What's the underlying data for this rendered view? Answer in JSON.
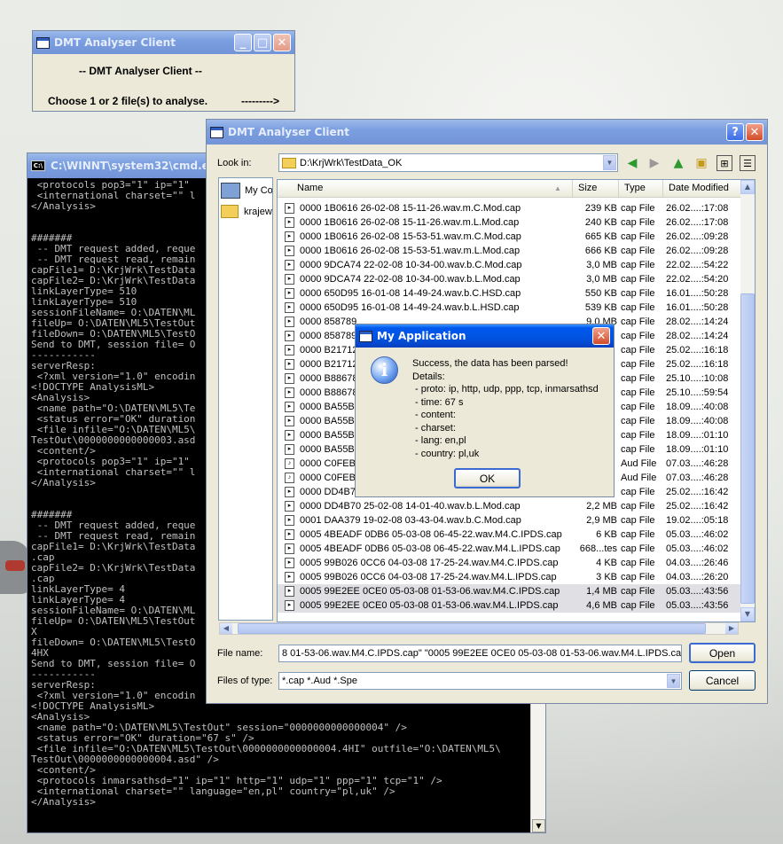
{
  "small_window": {
    "title": "DMT Analyser Client",
    "heading": "-- DMT Analyser Client --",
    "prompt": "Choose 1 or 2 file(s) to analyse.",
    "arrow": "--------->"
  },
  "cmd": {
    "title": "C:\\WINNT\\system32\\cmd.ex",
    "lines": [
      " <protocols pop3=\"1\" ip=\"1\"",
      " <international charset=\"\" l",
      "</Analysis>",
      "",
      "",
      "#######",
      " -- DMT request added, reque",
      " -- DMT request read, remain",
      "capFile1= D:\\KrjWrk\\TestData",
      "capFile2= D:\\KrjWrk\\TestData",
      "linkLayerType= 510",
      "linkLayerType= 510",
      "sessionFileName= O:\\DATEN\\ML",
      "fileUp= O:\\DATEN\\ML5\\TestOut",
      "fileDown= O:\\DATEN\\ML5\\TestO",
      "Send to DMT, session file= O",
      "-----------",
      "serverResp:",
      " <?xml version=\"1.0\" encodin",
      "<!DOCTYPE AnalysisML>",
      "<Analysis>",
      " <name path=\"O:\\DATEN\\ML5\\Te",
      " <status error=\"OK\" duration",
      " <file infile=\"O:\\DATEN\\ML5\\",
      "TestOut\\0000000000000003.asd",
      " <content/>",
      " <protocols pop3=\"1\" ip=\"1\"",
      " <international charset=\"\" l",
      "</Analysis>",
      "",
      "",
      "#######",
      " -- DMT request added, reque",
      " -- DMT request read, remain",
      "capFile1= D:\\KrjWrk\\TestData",
      ".cap",
      "capFile2= D:\\KrjWrk\\TestData",
      ".cap",
      "linkLayerType= 4",
      "linkLayerType= 4",
      "sessionFileName= O:\\DATEN\\ML",
      "fileUp= O:\\DATEN\\ML5\\TestOut",
      "X",
      "fileDown= O:\\DATEN\\ML5\\TestO",
      "4HX",
      "Send to DMT, session file= O",
      "-----------",
      "serverResp:",
      " <?xml version=\"1.0\" encodin",
      "<!DOCTYPE AnalysisML>",
      "<Analysis>",
      " <name path=\"O:\\DATEN\\ML5\\TestOut\" session=\"0000000000000004\" />",
      " <status error=\"OK\" duration=\"67 s\" />",
      " <file infile=\"O:\\DATEN\\ML5\\TestOut\\0000000000000004.4HI\" outfile=\"O:\\DATEN\\ML5\\",
      "TestOut\\0000000000000004.asd\" />",
      " <content/>",
      " <protocols inmarsathsd=\"1\" ip=\"1\" http=\"1\" udp=\"1\" ppp=\"1\" tcp=\"1\" />",
      " <international charset=\"\" language=\"en,pl\" country=\"pl,uk\" />",
      "</Analysis>"
    ]
  },
  "dialog": {
    "title": "DMT Analyser Client",
    "help_label": "?",
    "close_label": "✕",
    "look_in_label": "Look in:",
    "look_in_value": "D:\\KrjWrk\\TestData_OK",
    "places": [
      "My Co",
      "krajew"
    ],
    "columns": {
      "name": "Name",
      "size": "Size",
      "type": "Type",
      "modified": "Date Modified"
    },
    "files": [
      {
        "name": "0000 1B0616 26-02-08 15-11-26.wav.m.C.Mod.cap",
        "size": "239 KB",
        "type": "cap File",
        "date": "26.02....:17:08"
      },
      {
        "name": "0000 1B0616 26-02-08 15-11-26.wav.m.L.Mod.cap",
        "size": "240 KB",
        "type": "cap File",
        "date": "26.02....:17:08"
      },
      {
        "name": "0000 1B0616 26-02-08 15-53-51.wav.m.C.Mod.cap",
        "size": "665 KB",
        "type": "cap File",
        "date": "26.02....:09:28"
      },
      {
        "name": "0000 1B0616 26-02-08 15-53-51.wav.m.L.Mod.cap",
        "size": "666 KB",
        "type": "cap File",
        "date": "26.02....:09:28"
      },
      {
        "name": "0000 9DCA74 22-02-08 10-34-00.wav.b.C.Mod.cap",
        "size": "3,0 MB",
        "type": "cap File",
        "date": "22.02....:54:22"
      },
      {
        "name": "0000 9DCA74 22-02-08 10-34-00.wav.b.L.Mod.cap",
        "size": "3,0 MB",
        "type": "cap File",
        "date": "22.02....:54:20"
      },
      {
        "name": "0000 650D95 16-01-08 14-49-24.wav.b.C.HSD.cap",
        "size": "550 KB",
        "type": "cap File",
        "date": "16.01....:50:28"
      },
      {
        "name": "0000 650D95 16-01-08 14-49-24.wav.b.L.HSD.cap",
        "size": "539 KB",
        "type": "cap File",
        "date": "16.01....:50:28"
      },
      {
        "name": "0000 858789",
        "size": "9,0 MB",
        "type": "cap File",
        "date": "28.02....:14:24"
      },
      {
        "name": "0000 858789",
        "size": "",
        "type": "cap File",
        "date": "28.02....:14:24"
      },
      {
        "name": "0000 B21712",
        "size": "",
        "type": "cap File",
        "date": "25.02....:16:18"
      },
      {
        "name": "0000 B21712",
        "size": "",
        "type": "cap File",
        "date": "25.02....:16:18"
      },
      {
        "name": "0000 B88678",
        "size": "",
        "type": "cap File",
        "date": "25.10....:10:08"
      },
      {
        "name": "0000 B88678",
        "size": "",
        "type": "cap File",
        "date": "25.10....:59:54"
      },
      {
        "name": "0000 BA55B3",
        "size": "",
        "type": "cap File",
        "date": "18.09....:40:08"
      },
      {
        "name": "0000 BA55B3",
        "size": "",
        "type": "cap File",
        "date": "18.09....:40:08"
      },
      {
        "name": "0000 BA55B3",
        "size": "",
        "type": "cap File",
        "date": "18.09....:01:10"
      },
      {
        "name": "0000 BA55B3",
        "size": "",
        "type": "cap File",
        "date": "18.09....:01:10"
      },
      {
        "name": "0000 C0FEB6",
        "size": "",
        "type": "Aud File",
        "date": "07.03....:46:28"
      },
      {
        "name": "0000 C0FEB6",
        "size": "",
        "type": "Aud File",
        "date": "07.03....:46:28"
      },
      {
        "name": "0000 DD4B70",
        "size": "",
        "type": "cap File",
        "date": "25.02....:16:42"
      },
      {
        "name": "0000 DD4B70 25-02-08 14-01-40.wav.b.L.Mod.cap",
        "size": "2,2 MB",
        "type": "cap File",
        "date": "25.02....:16:42"
      },
      {
        "name": "0001 DAA379 19-02-08 03-43-04.wav.b.C.Mod.cap",
        "size": "2,9 MB",
        "type": "cap File",
        "date": "19.02....:05:18"
      },
      {
        "name": "0005 4BEADF 0DB6 05-03-08 06-45-22.wav.M4.C.IPDS.cap",
        "size": "6 KB",
        "type": "cap File",
        "date": "05.03....:46:02"
      },
      {
        "name": "0005 4BEADF 0DB6 05-03-08 06-45-22.wav.M4.L.IPDS.cap",
        "size": "668...tes",
        "type": "cap File",
        "date": "05.03....:46:02"
      },
      {
        "name": "0005 99B026 0CC6 04-03-08 17-25-24.wav.M4.C.IPDS.cap",
        "size": "4 KB",
        "type": "cap File",
        "date": "04.03....:26:46"
      },
      {
        "name": "0005 99B026 0CC6 04-03-08 17-25-24.wav.M4.L.IPDS.cap",
        "size": "3 KB",
        "type": "cap File",
        "date": "04.03....:26:20"
      },
      {
        "name": "0005 99E2EE 0CE0 05-03-08 01-53-06.wav.M4.C.IPDS.cap",
        "size": "1,4 MB",
        "type": "cap File",
        "date": "05.03....:43:56"
      },
      {
        "name": "0005 99E2EE 0CE0 05-03-08 01-53-06.wav.M4.L.IPDS.cap",
        "size": "4,6 MB",
        "type": "cap File",
        "date": "05.03....:43:56"
      }
    ],
    "file_name_label": "File name:",
    "file_name_value": "8 01-53-06.wav.M4.C.IPDS.cap\" \"0005 99E2EE 0CE0 05-03-08 01-53-06.wav.M4.L.IPDS.cap\"",
    "files_of_type_label": "Files of type:",
    "files_of_type_value": "*.cap *.Aud *.Spe",
    "open_label": "Open",
    "cancel_label": "Cancel"
  },
  "message_box": {
    "title": "My Application",
    "line1": "Success, the data has been parsed!",
    "line2": "Details:",
    "details": [
      " - proto: ip, http, udp, ppp, tcp, inmarsathsd",
      " - time: 67 s",
      " - content:",
      " - charset:",
      " - lang: en,pl",
      " - country: pl,uk"
    ],
    "ok_label": "OK"
  },
  "colors": {
    "titlebar": "#0058ee",
    "cmd_text": "#c0c0c0",
    "selection": "#e0dfe3"
  }
}
